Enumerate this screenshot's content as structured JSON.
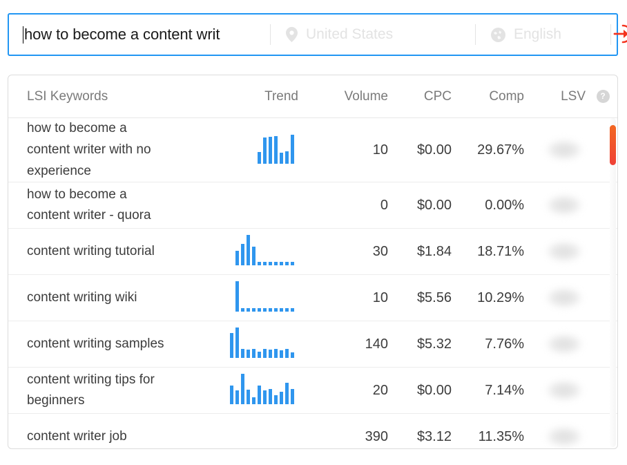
{
  "search": {
    "query_value": "how to become a content writ",
    "geo_label": "United States",
    "geo_icon": "map-pin-icon",
    "lang_label": "English",
    "lang_icon": "globe-icon",
    "submit_icon": "arrow-into-circle-icon",
    "accent_border": "#2196f3",
    "submit_color": "#f4341f"
  },
  "table": {
    "headers": {
      "keyword": "LSI Keywords",
      "trend": "Trend",
      "volume": "Volume",
      "cpc": "CPC",
      "comp": "Comp",
      "lsv": "LSV",
      "help": "?"
    },
    "rows": [
      {
        "keyword": "how to become a content writer with no experience",
        "volume": "10",
        "cpc": "$0.00",
        "comp": "29.67%",
        "lsv": "",
        "trend": [
          38,
          86,
          88,
          90,
          36,
          40,
          95
        ]
      },
      {
        "keyword": "how to become a content writer - quora",
        "volume": "0",
        "cpc": "$0.00",
        "comp": "0.00%",
        "lsv": "",
        "trend": []
      },
      {
        "keyword": "content writing tutorial",
        "volume": "30",
        "cpc": "$1.84",
        "comp": "18.71%",
        "lsv": "",
        "trend": [
          48,
          70,
          100,
          60,
          12,
          10,
          10,
          10,
          10,
          10,
          10
        ]
      },
      {
        "keyword": "content writing wiki",
        "volume": "10",
        "cpc": "$5.56",
        "comp": "10.29%",
        "lsv": "",
        "trend": [
          100,
          12,
          12,
          12,
          12,
          12,
          12,
          12,
          12,
          12,
          12
        ]
      },
      {
        "keyword": "content writing samples",
        "volume": "140",
        "cpc": "$5.32",
        "comp": "7.76%",
        "lsv": "",
        "trend": [
          82,
          100,
          30,
          26,
          30,
          20,
          30,
          26,
          30,
          24,
          30,
          18
        ]
      },
      {
        "keyword": "content writing tips for beginners",
        "volume": "20",
        "cpc": "$0.00",
        "comp": "7.14%",
        "lsv": "",
        "trend": [
          62,
          45,
          100,
          48,
          22,
          62,
          45,
          50,
          30,
          40,
          70,
          50
        ]
      },
      {
        "keyword": "content writer job",
        "volume": "390",
        "cpc": "$3.12",
        "comp": "11.35%",
        "lsv": "",
        "trend": []
      }
    ]
  },
  "scrollbar": {
    "thumb_color_start": "#f26722",
    "thumb_color_end": "#ef4136"
  },
  "chart_data": {
    "type": "table",
    "title": "LSI Keywords",
    "columns": [
      "LSI Keywords",
      "Trend",
      "Volume",
      "CPC",
      "Comp",
      "LSV"
    ],
    "rows": [
      [
        "how to become a content writer with no experience",
        "sparkline",
        "10",
        "$0.00",
        "29.67%",
        "hidden"
      ],
      [
        "how to become a content writer - quora",
        "",
        "0",
        "$0.00",
        "0.00%",
        "hidden"
      ],
      [
        "content writing tutorial",
        "sparkline",
        "30",
        "$1.84",
        "18.71%",
        "hidden"
      ],
      [
        "content writing wiki",
        "sparkline",
        "10",
        "$5.56",
        "10.29%",
        "hidden"
      ],
      [
        "content writing samples",
        "sparkline",
        "140",
        "$5.32",
        "7.76%",
        "hidden"
      ],
      [
        "content writing tips for beginners",
        "sparkline",
        "20",
        "$0.00",
        "7.14%",
        "hidden"
      ],
      [
        "content writer job",
        "",
        "390",
        "$3.12",
        "11.35%",
        "hidden"
      ]
    ]
  }
}
